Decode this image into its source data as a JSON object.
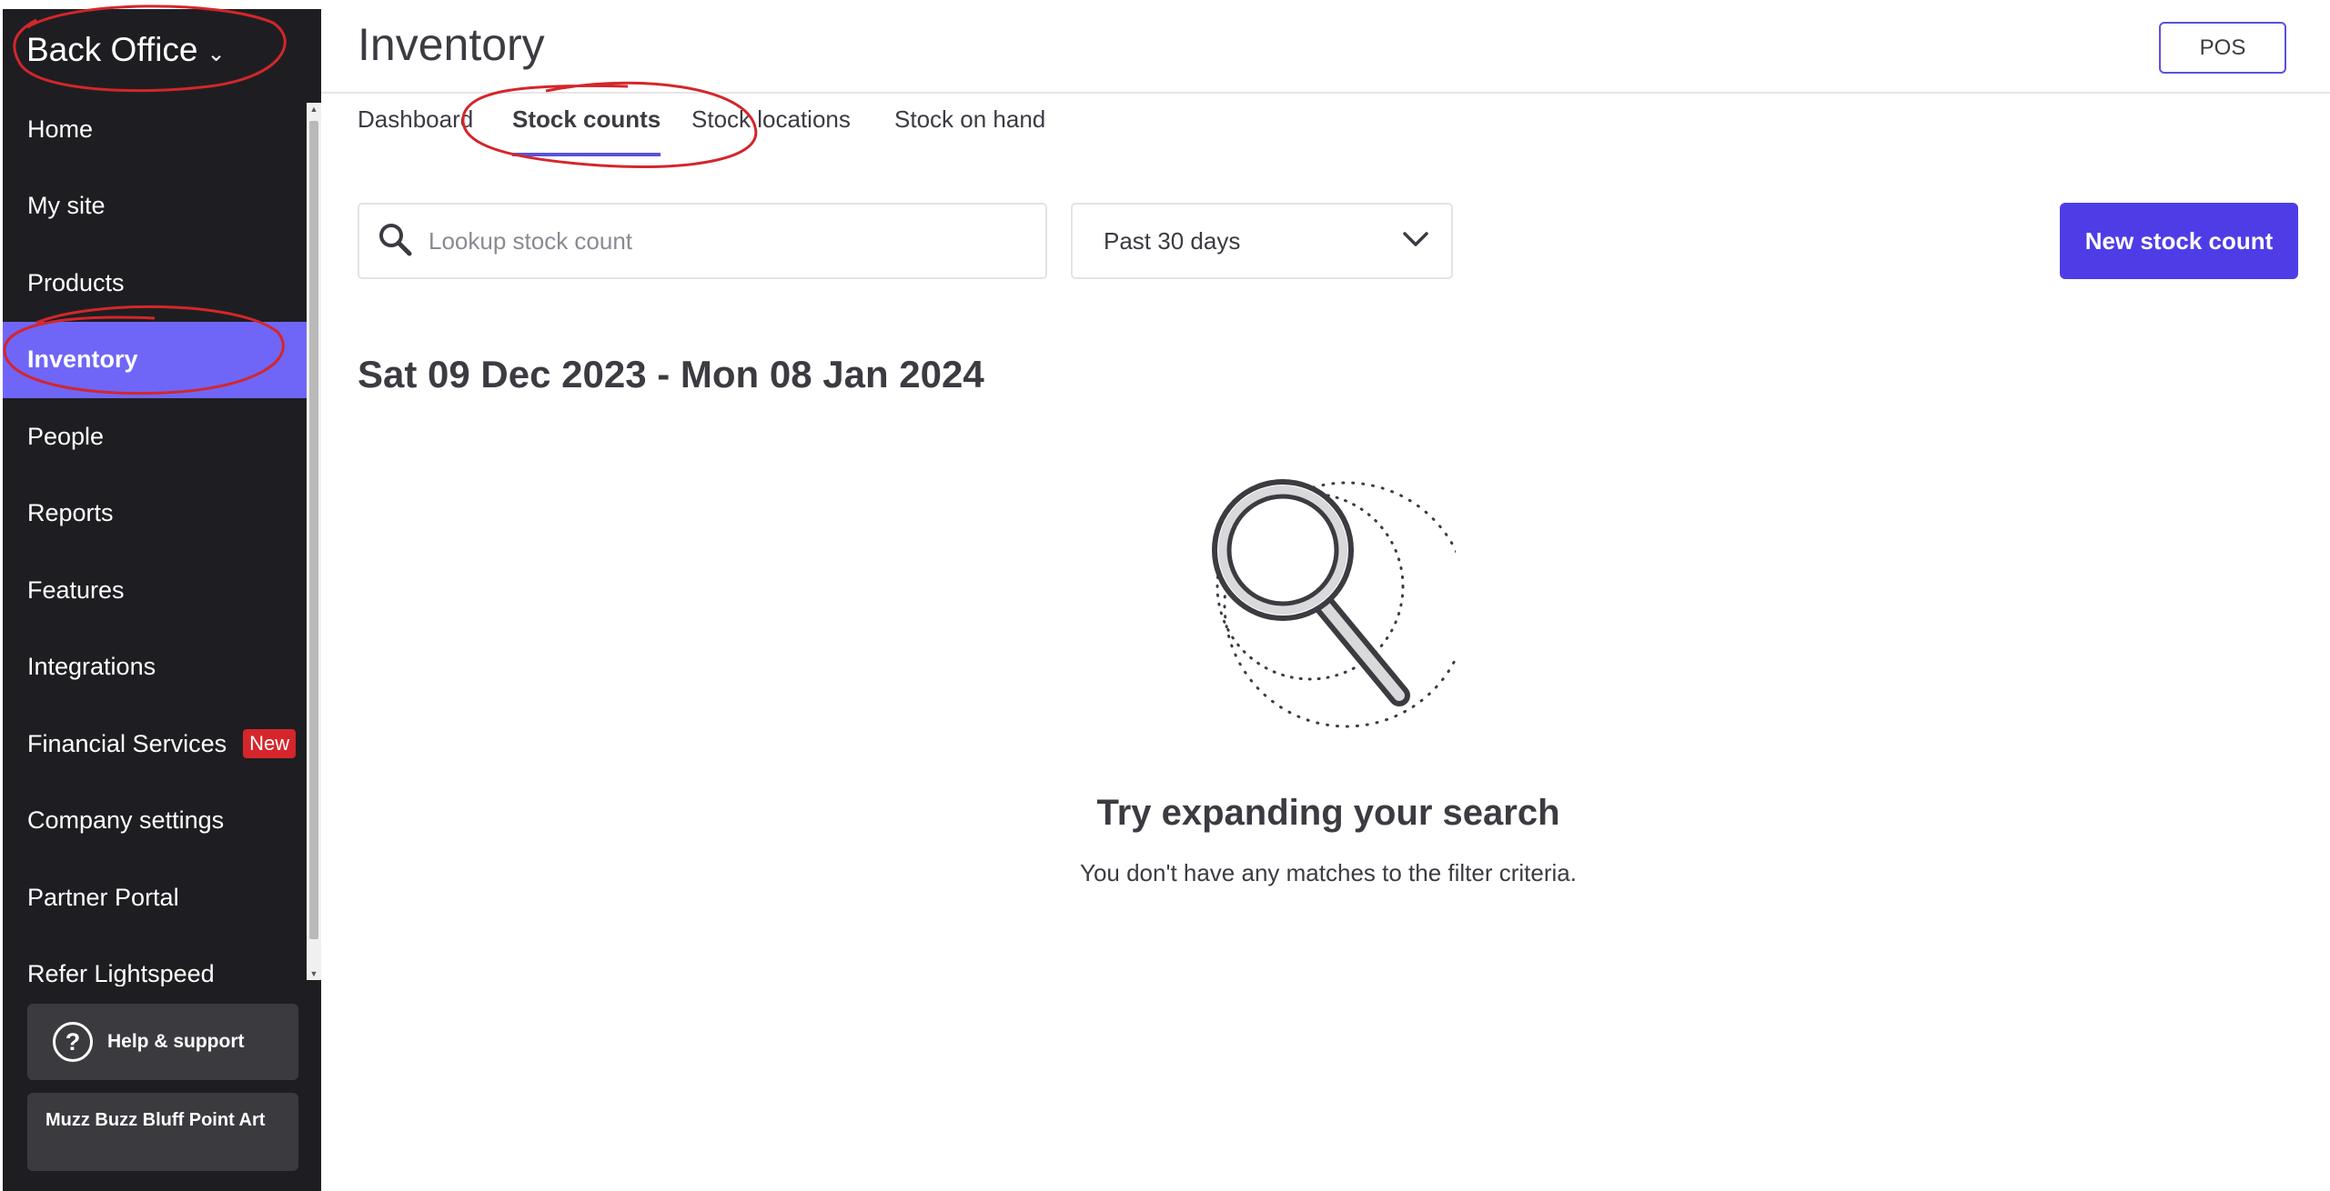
{
  "sidebar": {
    "brand": "Back Office",
    "items": [
      {
        "label": "Home"
      },
      {
        "label": "My site"
      },
      {
        "label": "Products"
      },
      {
        "label": "Inventory",
        "active": true
      },
      {
        "label": "People"
      },
      {
        "label": "Reports"
      },
      {
        "label": "Features"
      },
      {
        "label": "Integrations"
      },
      {
        "label": "Financial Services",
        "badge": "New"
      },
      {
        "label": "Company settings"
      },
      {
        "label": "Partner Portal"
      },
      {
        "label": "Refer Lightspeed"
      }
    ],
    "help_label": "Help & support",
    "account_name": "Muzz Buzz Bluff Point Art",
    "colors": {
      "background": "#1e1e22",
      "active": "#6f66f7",
      "badge": "#d4262b"
    }
  },
  "header": {
    "title": "Inventory",
    "pos_button": "POS"
  },
  "tabs": [
    {
      "label": "Dashboard"
    },
    {
      "label": "Stock counts",
      "active": true
    },
    {
      "label": "Stock locations"
    },
    {
      "label": "Stock on hand"
    }
  ],
  "filters": {
    "search_placeholder": "Lookup stock count",
    "search_value": "",
    "date_filter": "Past 30 days",
    "new_button": "New stock count"
  },
  "date_range": "Sat 09 Dec 2023 - Mon 08 Jan 2024",
  "empty_state": {
    "title": "Try expanding your search",
    "subtitle": "You don't have any matches to the filter criteria."
  },
  "colors": {
    "accent": "#4e3de6",
    "text": "#3b3b42",
    "annotation": "#d4262b"
  }
}
